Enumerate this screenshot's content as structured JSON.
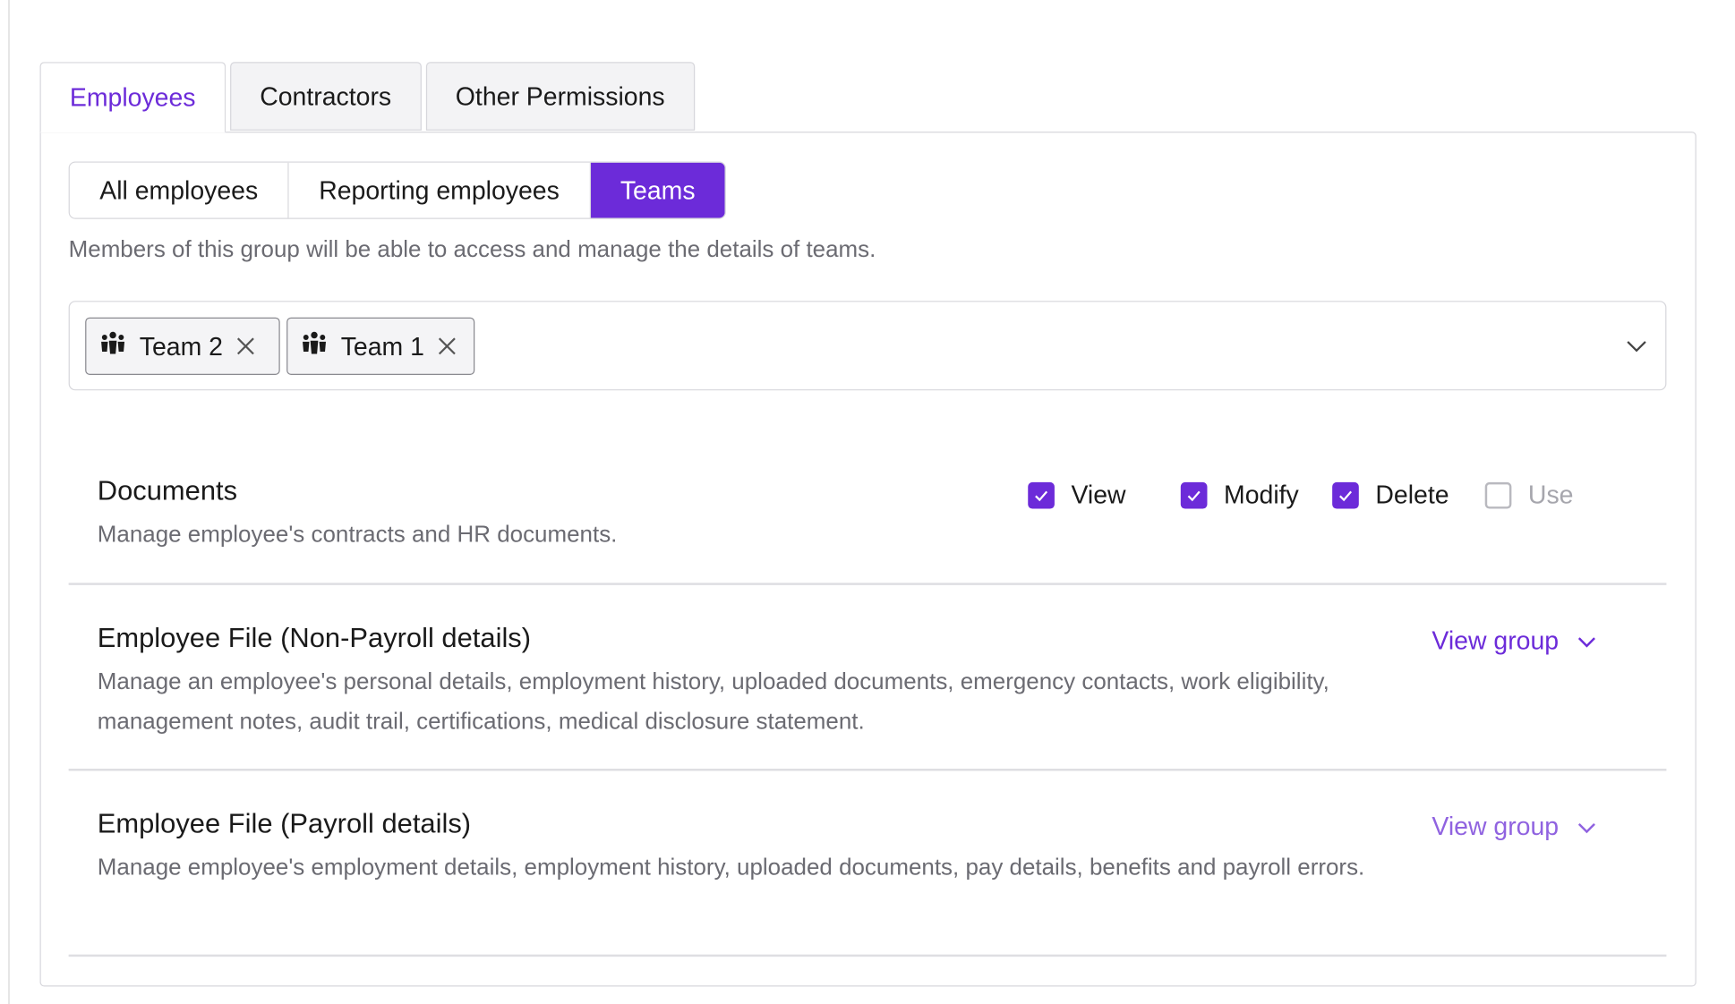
{
  "tabs": [
    {
      "label": "Employees",
      "active": true
    },
    {
      "label": "Contractors",
      "active": false
    },
    {
      "label": "Other Permissions",
      "active": false
    }
  ],
  "segments": [
    {
      "label": "All employees",
      "active": false
    },
    {
      "label": "Reporting employees",
      "active": false
    },
    {
      "label": "Teams",
      "active": true
    }
  ],
  "helper_text": "Members of this group will be able to access and manage the details of teams.",
  "team_select": {
    "chips": [
      {
        "label": "Team 2",
        "icon": "team-icon"
      },
      {
        "label": "Team 1",
        "icon": "team-icon"
      }
    ]
  },
  "permissions": [
    {
      "title": "Documents",
      "description": "Manage employee's contracts and HR documents.",
      "checkboxes": [
        {
          "label": "View",
          "checked": true,
          "disabled": false
        },
        {
          "label": "Modify",
          "checked": true,
          "disabled": false
        },
        {
          "label": "Delete",
          "checked": true,
          "disabled": false
        },
        {
          "label": "Use",
          "checked": false,
          "disabled": true
        }
      ]
    },
    {
      "title": "Employee File (Non-Payroll details)",
      "description": "Manage an employee's personal details, employment history, uploaded documents, emergency contacts, work eligibility, management notes, audit trail, certifications, medical disclosure statement.",
      "action_label": "View group"
    },
    {
      "title": "Employee File (Payroll details)",
      "description": "Manage employee's employment details, employment history, uploaded documents, pay details, benefits and payroll errors.",
      "action_label": "View group"
    }
  ],
  "colors": {
    "accent": "#6c2bd9",
    "accent_muted": "#9063e0",
    "border": "#d7d7dc",
    "muted_text": "#6b6b72"
  }
}
